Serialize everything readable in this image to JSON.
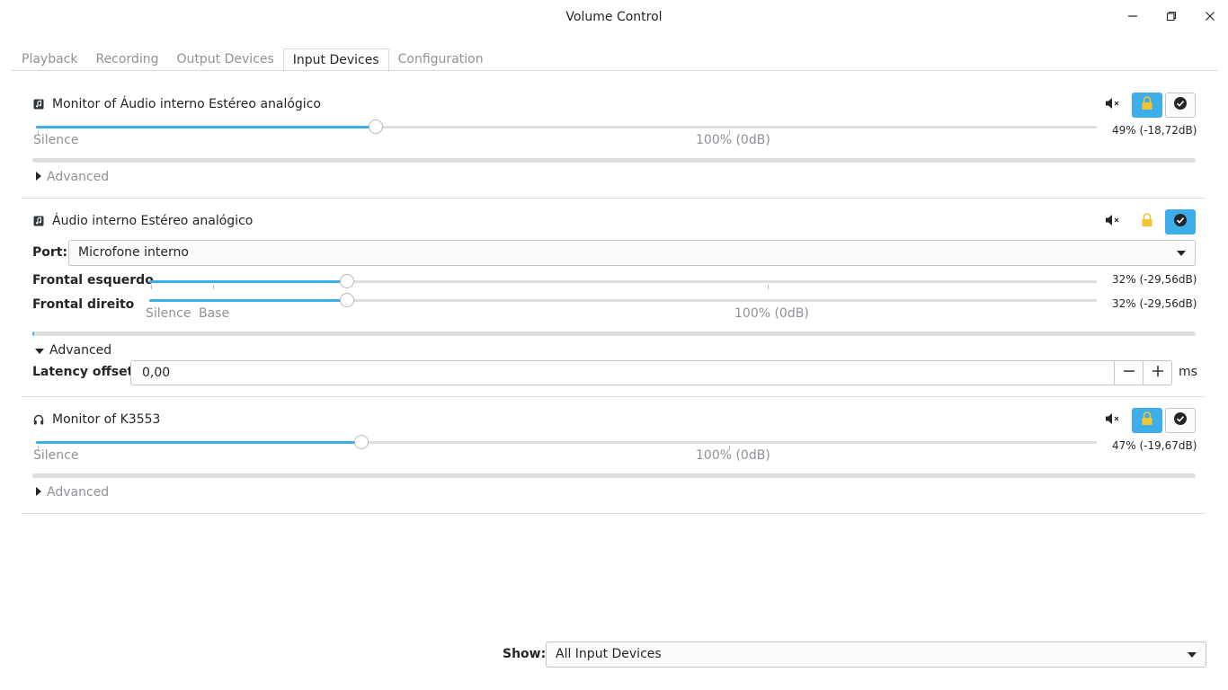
{
  "window": {
    "title": "Volume Control"
  },
  "tabs": [
    {
      "label": "Playback",
      "active": false
    },
    {
      "label": "Recording",
      "active": false
    },
    {
      "label": "Output Devices",
      "active": false
    },
    {
      "label": "Input Devices",
      "active": true
    },
    {
      "label": "Configuration",
      "active": false
    }
  ],
  "devices": [
    {
      "icon": "audio-card-icon",
      "name": "Monitor of Áudio interno Estéreo analógico",
      "volume_label": "49% (-18,72dB)",
      "volume_fraction": 0.49,
      "silence_label": "Silence",
      "hundred_label": "100% (0dB)",
      "lock_active": true,
      "default_active": false,
      "advanced_label": "Advanced",
      "advanced_expanded": false
    },
    {
      "icon": "audio-card-icon",
      "name": "Áudio interno Estéreo analógico",
      "port_label": "Port:",
      "port_value": "Microfone interno",
      "channels": [
        {
          "name": "Frontal esquerdo",
          "volume_label": "32% (-29,56dB)",
          "volume_fraction": 0.32
        },
        {
          "name": "Frontal direito",
          "volume_label": "32% (-29,56dB)",
          "volume_fraction": 0.32
        }
      ],
      "silence_label": "Silence",
      "base_label": "Base",
      "hundred_label": "100% (0dB)",
      "lock_active": false,
      "default_active": true,
      "advanced_label": "Advanced",
      "advanced_expanded": true,
      "latency_label": "Latency offset:",
      "latency_value": "0,00",
      "latency_unit": "ms"
    },
    {
      "icon": "headphones-icon",
      "name": "Monitor of K3553",
      "volume_label": "47% (-19,67dB)",
      "volume_fraction": 0.47,
      "silence_label": "Silence",
      "hundred_label": "100% (0dB)",
      "lock_active": true,
      "default_active": false,
      "advanced_label": "Advanced",
      "advanced_expanded": false
    }
  ],
  "footer": {
    "show_label": "Show:",
    "show_value": "All Input Devices"
  },
  "colors": {
    "accent": "#3daee9",
    "lock": "#f5c330"
  }
}
